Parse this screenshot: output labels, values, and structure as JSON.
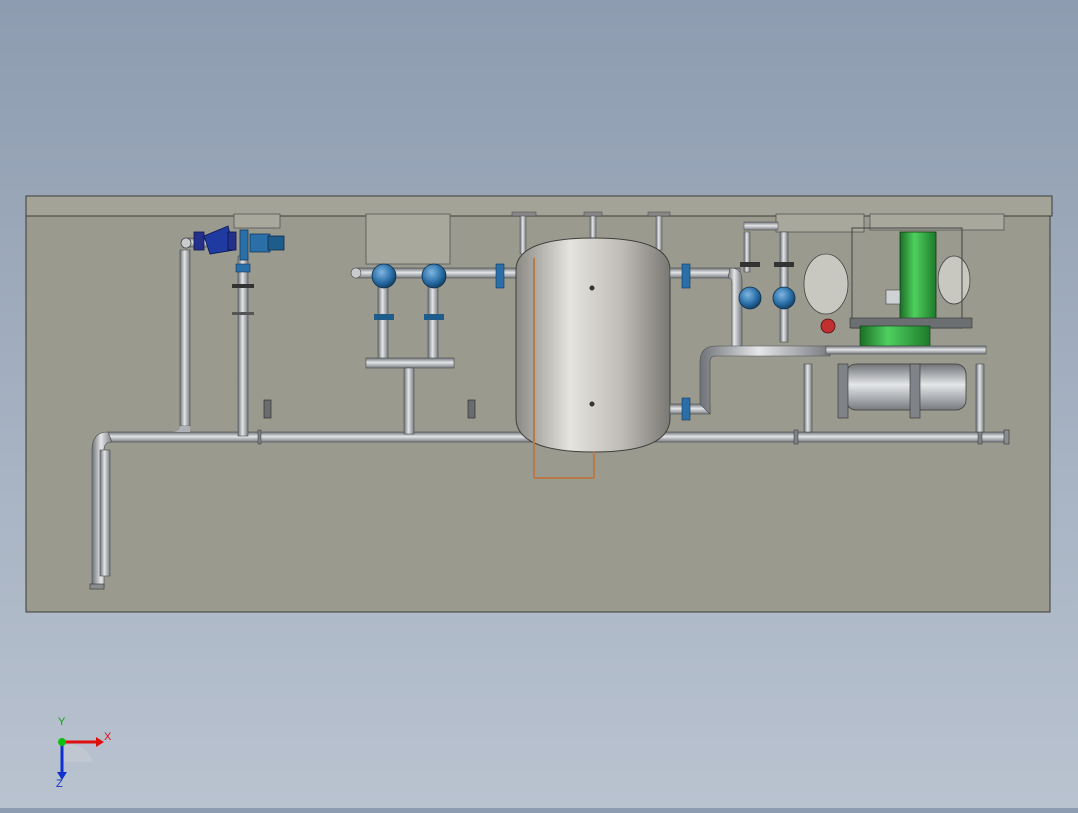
{
  "viewport": {
    "background_top": "#8d9cb0",
    "background_bottom": "#b9c3d0"
  },
  "model": {
    "skid_color": "#9a9a8f",
    "pipe_color": "#b8bcc0",
    "tank_color": "#b4b2ad",
    "valve_color": "#2a6fa8",
    "motor_color": "#2f9a3c",
    "strainer_color": "#1f3aa0"
  },
  "triad": {
    "x_label": "X",
    "y_label": "Y",
    "z_label": "Z",
    "x_color": "#e01010",
    "y_color": "#10c010",
    "z_color": "#1030d0"
  }
}
